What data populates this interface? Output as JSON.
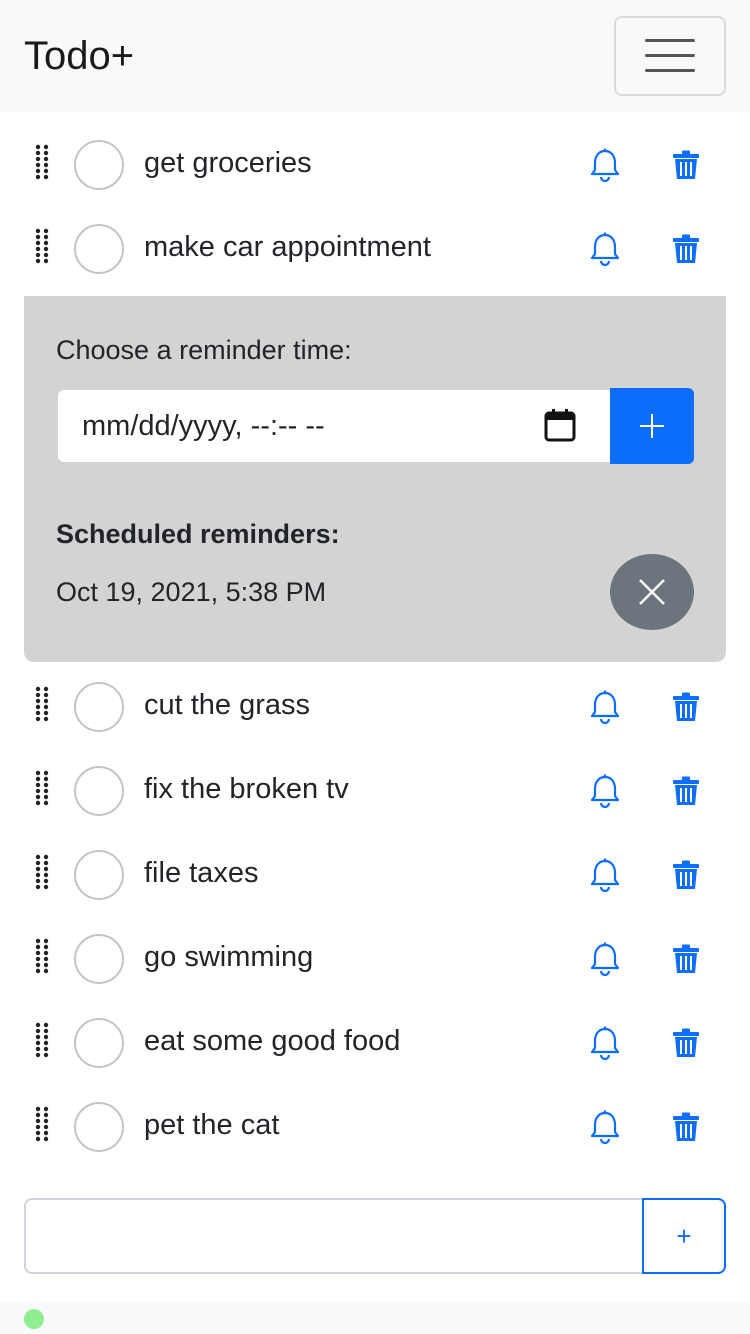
{
  "app": {
    "title": "Todo+"
  },
  "colors": {
    "accent": "#0d6efd",
    "panel": "#d3d3d3",
    "secondary": "#6c757d",
    "status": "#90ee90"
  },
  "icons": {
    "menu": "hamburger-menu-icon",
    "drag": "grip-vertical-icon",
    "reminder": "bell-icon",
    "delete": "trash-icon",
    "calendar": "calendar-icon",
    "add": "plus-icon",
    "remove": "close-icon"
  },
  "todos": [
    {
      "text": "get groceries",
      "completed": false
    },
    {
      "text": "make car appointment",
      "completed": false
    },
    {
      "text": "cut the grass",
      "completed": false
    },
    {
      "text": "fix the broken tv",
      "completed": false
    },
    {
      "text": "file taxes",
      "completed": false
    },
    {
      "text": "go swimming",
      "completed": false
    },
    {
      "text": "eat some good food",
      "completed": false
    },
    {
      "text": "pet the cat",
      "completed": false
    }
  ],
  "reminder_panel": {
    "label": "Choose a reminder time:",
    "datetime_placeholder": "mm/dd/yyyy, --:-- --",
    "scheduled_title": "Scheduled reminders:",
    "scheduled": [
      "Oct 19, 2021, 5:38 PM"
    ]
  },
  "new_todo": {
    "value": "",
    "add_label": "+"
  }
}
